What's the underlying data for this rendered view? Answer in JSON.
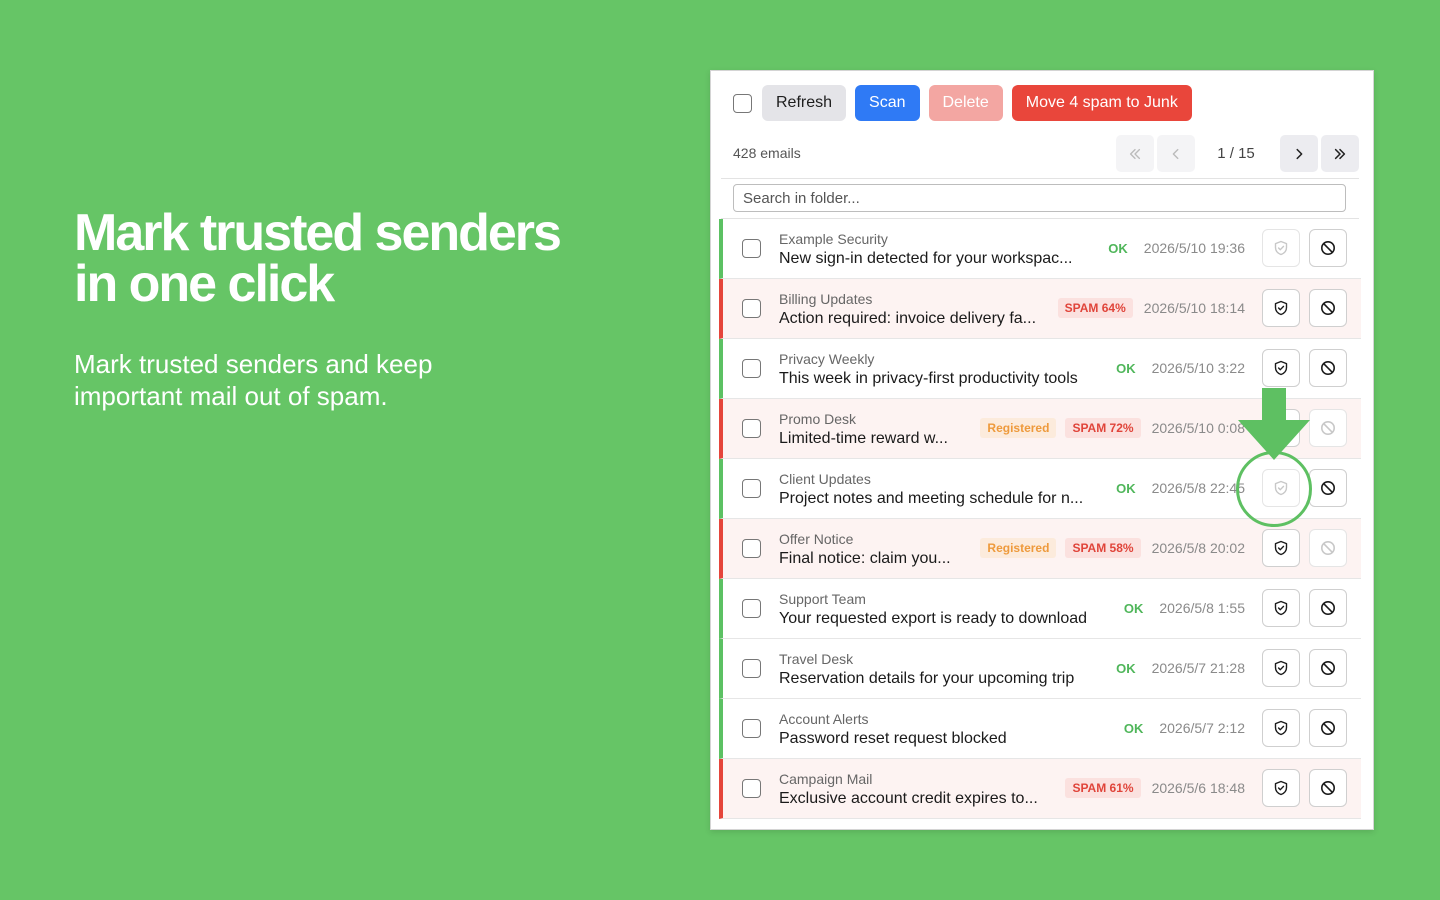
{
  "hero": {
    "title_line1": "Mark trusted senders",
    "title_line2": "in one click",
    "subtitle_line1": "Mark trusted senders and keep",
    "subtitle_line2": "important mail out of spam."
  },
  "toolbar": {
    "refresh_label": "Refresh",
    "scan_label": "Scan",
    "delete_label": "Delete",
    "junk_label": "Move 4 spam to Junk"
  },
  "pager": {
    "email_count": "428 emails",
    "page_text": "1 / 15"
  },
  "search": {
    "placeholder": "Search in folder..."
  },
  "colors": {
    "background": "#66c566",
    "ok": "#5cc163",
    "spam": "#e5453b",
    "scan": "#2f7af5",
    "registered": "#ee9a3c"
  },
  "icons": {
    "trust": "shield-check-icon",
    "block": "block-icon",
    "first": "double-chevron-left-icon",
    "prev": "chevron-left-icon",
    "next": "chevron-right-icon",
    "last": "double-chevron-right-icon"
  },
  "emails": [
    {
      "sender": "Example Security",
      "subject": "New sign-in detected for your workspac...",
      "status": "ok",
      "status_label": "OK",
      "registered": "",
      "date": "2026/5/10 19:36"
    },
    {
      "sender": "Billing Updates",
      "subject": "Action required: invoice delivery fa...",
      "status": "spam",
      "status_label": "SPAM 64%",
      "registered": "",
      "date": "2026/5/10 18:14"
    },
    {
      "sender": "Privacy Weekly",
      "subject": "This week in privacy-first productivity tools",
      "status": "ok",
      "status_label": "OK",
      "registered": "",
      "date": "2026/5/10 3:22"
    },
    {
      "sender": "Promo Desk",
      "subject": "Limited-time reward w...",
      "status": "spam",
      "status_label": "SPAM 72%",
      "registered": "Registered",
      "date": "2026/5/10 0:08"
    },
    {
      "sender": "Client Updates",
      "subject": "Project notes and meeting schedule for n...",
      "status": "ok",
      "status_label": "OK",
      "registered": "",
      "date": "2026/5/8 22:45"
    },
    {
      "sender": "Offer Notice",
      "subject": "Final notice: claim you...",
      "status": "spam",
      "status_label": "SPAM 58%",
      "registered": "Registered",
      "date": "2026/5/8 20:02"
    },
    {
      "sender": "Support Team",
      "subject": "Your requested export is ready to download",
      "status": "ok",
      "status_label": "OK",
      "registered": "",
      "date": "2026/5/8 1:55"
    },
    {
      "sender": "Travel Desk",
      "subject": "Reservation details for your upcoming trip",
      "status": "ok",
      "status_label": "OK",
      "registered": "",
      "date": "2026/5/7 21:28"
    },
    {
      "sender": "Account Alerts",
      "subject": "Password reset request blocked",
      "status": "ok",
      "status_label": "OK",
      "registered": "",
      "date": "2026/5/7 2:12"
    },
    {
      "sender": "Campaign Mail",
      "subject": "Exclusive account credit expires to...",
      "status": "spam",
      "status_label": "SPAM 61%",
      "registered": "",
      "date": "2026/5/6 18:48"
    }
  ]
}
